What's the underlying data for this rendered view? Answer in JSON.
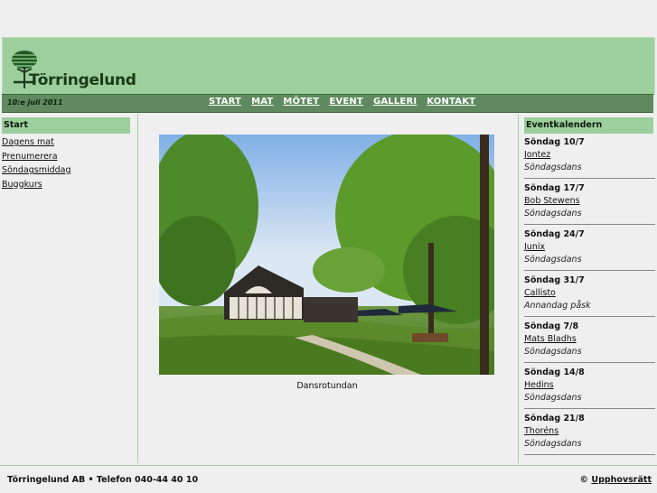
{
  "header": {
    "logo_text": "Törringelund"
  },
  "navbar": {
    "date": "10:e juli 2011",
    "items": [
      "START",
      "MAT",
      "MÖTET",
      "EVENT",
      "GALLERI",
      "KONTAKT"
    ]
  },
  "left": {
    "heading": "Start",
    "links": [
      "Dagens mat",
      "Prenumerera",
      "Söndagsmiddag",
      "Buggkurs"
    ]
  },
  "main": {
    "caption": "Dansrotundan"
  },
  "right": {
    "heading": "Eventkalendern",
    "events": [
      {
        "day": "Söndag 10/7",
        "artist": "Jontez",
        "type": "Söndagsdans"
      },
      {
        "day": "Söndag 17/7",
        "artist": "Bob Stewens",
        "type": "Söndagsdans"
      },
      {
        "day": "Söndag 24/7",
        "artist": "Junix",
        "type": "Söndagsdans"
      },
      {
        "day": "Söndag 31/7",
        "artist": "Callisto",
        "type": "Annandag påsk"
      },
      {
        "day": "Söndag 7/8",
        "artist": "Mats Bladhs",
        "type": "Söndagsdans"
      },
      {
        "day": "Söndag 14/8",
        "artist": "Hedins",
        "type": "Söndagsdans"
      },
      {
        "day": "Söndag 21/8",
        "artist": "Thoréns",
        "type": "Söndagsdans"
      }
    ]
  },
  "footer": {
    "left": "Törringelund AB • Telefon 040-44 40 10",
    "copyright_symbol": "©",
    "copyright_link": "Upphovsrätt"
  },
  "colors": {
    "header_green": "#9ccf9c",
    "nav_green": "#5f8a5f",
    "background": "#efefef"
  }
}
